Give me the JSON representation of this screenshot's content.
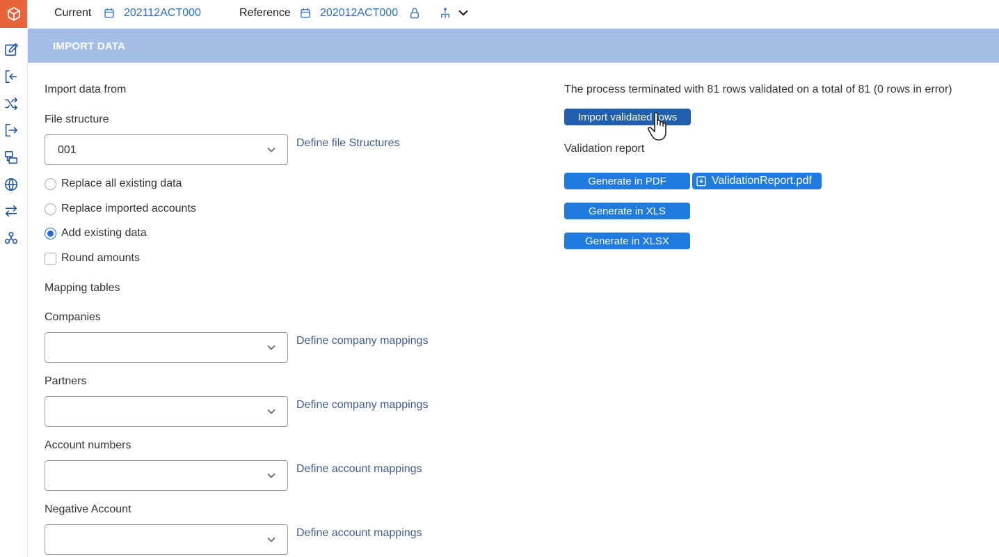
{
  "topbar": {
    "current_label": "Current",
    "current_value": "202112ACT000",
    "reference_label": "Reference",
    "reference_value": "202012ACT000"
  },
  "section": {
    "title": "IMPORT DATA"
  },
  "form": {
    "import_from_label": "Import data from",
    "file_structure_label": "File structure",
    "file_structure_value": "001",
    "define_file_structures": "Define file Structures",
    "options": [
      {
        "label": "Replace all existing data",
        "type": "radio",
        "selected": false
      },
      {
        "label": "Replace imported accounts",
        "type": "radio",
        "selected": false
      },
      {
        "label": "Add existing data",
        "type": "radio",
        "selected": true
      },
      {
        "label": "Round amounts",
        "type": "checkbox",
        "checked": false
      }
    ],
    "mapping_tables_label": "Mapping tables",
    "companies_label": "Companies",
    "companies_link": "Define company mappings",
    "partners_label": "Partners",
    "partners_link": "Define company mappings",
    "account_numbers_label": "Account numbers",
    "account_numbers_link": "Define account mappings",
    "negative_account_label": "Negative Account",
    "negative_account_link": "Define account mappings"
  },
  "results": {
    "status_text": "The process terminated with 81 rows validated on a total of 81 (0 rows in error)",
    "import_button": "Import validated rows",
    "validation_report_label": "Validation report",
    "pdf_button": "Generate in PDF",
    "pdf_file": "ValidationReport.pdf",
    "xls_button": "Generate in XLS",
    "xlsx_button": "Generate in XLSX"
  },
  "colors": {
    "accent": "#1f7be0",
    "header_band": "#a3bde6",
    "logo": "#e8643a",
    "link": "#2a6fc9"
  }
}
